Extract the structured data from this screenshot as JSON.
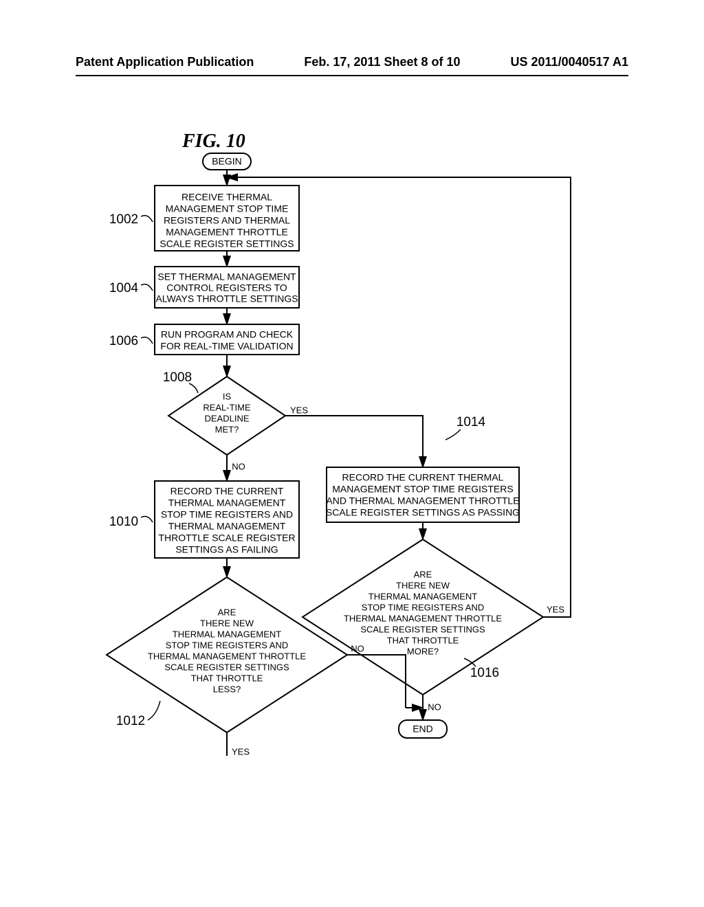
{
  "header": {
    "left": "Patent Application Publication",
    "center": "Feb. 17, 2011  Sheet 8 of 10",
    "right": "US 2011/0040517 A1"
  },
  "figure_title": "FIG. 10",
  "terminators": {
    "begin": "BEGIN",
    "end": "END"
  },
  "boxes": {
    "b1002": [
      "RECEIVE THERMAL",
      "MANAGEMENT STOP TIME",
      "REGISTERS AND THERMAL",
      "MANAGEMENT THROTTLE",
      "SCALE REGISTER SETTINGS"
    ],
    "b1004": [
      "SET THERMAL MANAGEMENT",
      "CONTROL REGISTERS TO",
      "ALWAYS THROTTLE SETTINGS"
    ],
    "b1006": [
      "RUN PROGRAM AND CHECK",
      "FOR REAL-TIME VALIDATION"
    ],
    "b1010": [
      "RECORD THE CURRENT",
      "THERMAL MANAGEMENT",
      "STOP TIME REGISTERS AND",
      "THERMAL MANAGEMENT",
      "THROTTLE SCALE REGISTER",
      "SETTINGS AS FAILING"
    ],
    "b1014": [
      "RECORD THE CURRENT THERMAL",
      "MANAGEMENT STOP TIME REGISTERS",
      "AND THERMAL MANAGEMENT THROTTLE",
      "SCALE REGISTER SETTINGS AS PASSING"
    ]
  },
  "diamonds": {
    "d1008": [
      "IS",
      "REAL-TIME",
      "DEADLINE",
      "MET?"
    ],
    "d1012": [
      "ARE",
      "THERE NEW",
      "THERMAL MANAGEMENT",
      "STOP TIME REGISTERS AND",
      "THERMAL MANAGEMENT THROTTLE",
      "SCALE REGISTER SETTINGS",
      "THAT THROTTLE",
      "LESS?"
    ],
    "d1016": [
      "ARE",
      "THERE NEW",
      "THERMAL MANAGEMENT",
      "STOP TIME REGISTERS AND",
      "THERMAL MANAGEMENT THROTTLE",
      "SCALE REGISTER SETTINGS",
      "THAT THROTTLE",
      "MORE?"
    ]
  },
  "labels": {
    "l1002": "1002",
    "l1004": "1004",
    "l1006": "1006",
    "l1008": "1008",
    "l1010": "1010",
    "l1012": "1012",
    "l1014": "1014",
    "l1016": "1016"
  },
  "yn": {
    "yes": "YES",
    "no": "NO"
  }
}
